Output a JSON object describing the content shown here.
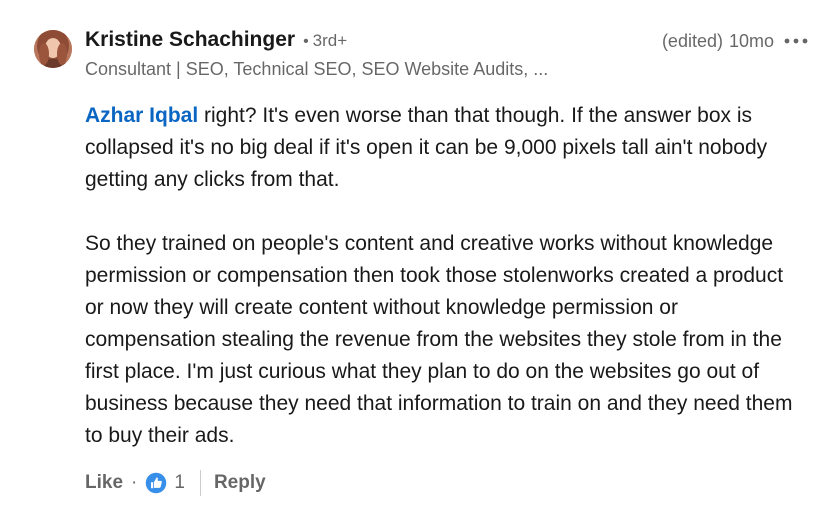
{
  "comment": {
    "author": {
      "name": "Kristine Schachinger",
      "degree": "3rd+",
      "headline": "Consultant | SEO, Technical SEO, SEO Website Audits, ..."
    },
    "edited_label": "(edited)",
    "timestamp": "10mo",
    "more_icon": "ellipsis-icon",
    "body": {
      "mention": "Azhar Iqbal",
      "paragraph1_rest": " right? It's even worse than that though. If the answer box is collapsed it's no big deal if it's open it can be 9,000 pixels tall ain't nobody getting any clicks from that.",
      "paragraph2": "So they trained on people's content and creative works without knowledge permission or compensation then took those stolenworks created a product or now they will create content without knowledge permission or compensation stealing the revenue from the websites they stole from in the first place. I'm just curious what they plan to do on the websites go out of business because they need that information to train on and they need them to buy their ads."
    },
    "actions": {
      "like_label": "Like",
      "separator": "·",
      "reaction_icon": "like-reaction-icon",
      "reaction_count": "1",
      "reply_label": "Reply"
    }
  },
  "colors": {
    "link": "#0a66c2",
    "like_reaction": "#378fe9"
  }
}
